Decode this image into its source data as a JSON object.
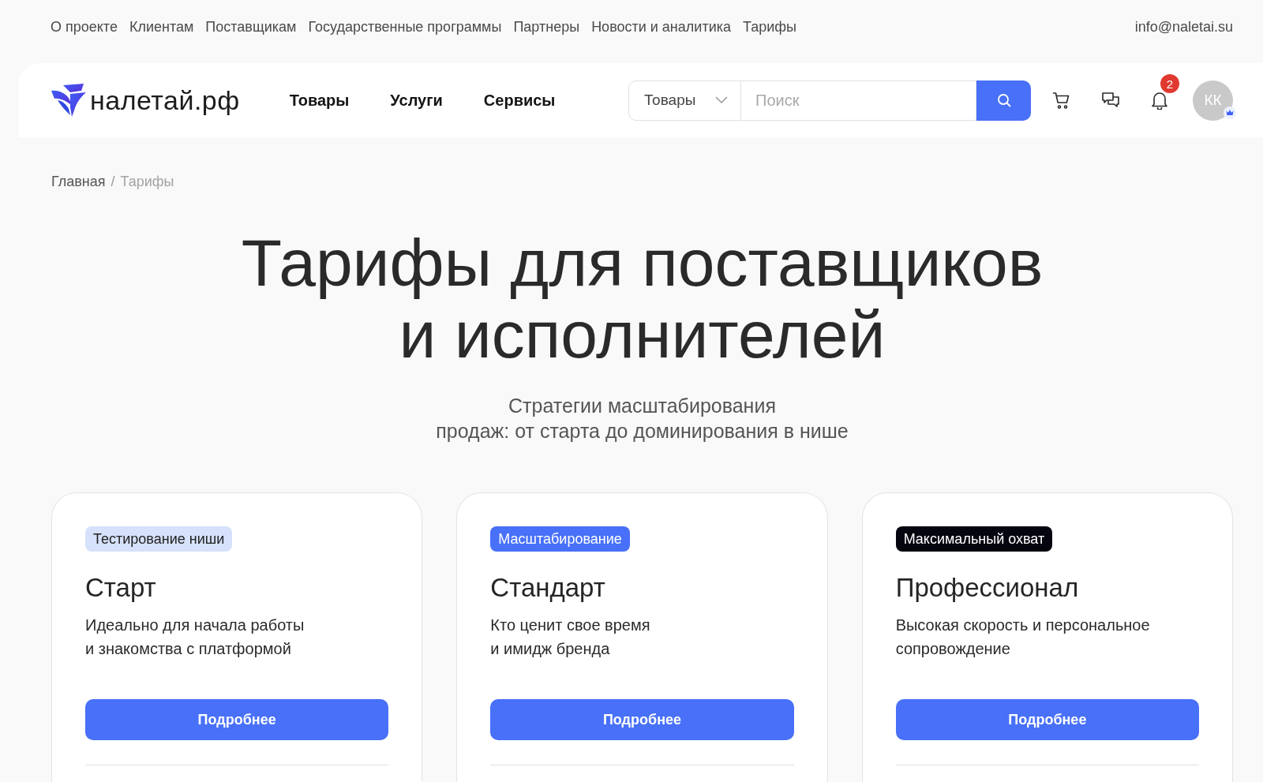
{
  "top_nav": {
    "links": [
      "О проекте",
      "Клиентам",
      "Поставщикам",
      "Государственные программы",
      "Партнеры",
      "Новости и аналитика",
      "Тарифы"
    ],
    "email": "info@naletai.su"
  },
  "header": {
    "logo": "налетай.рф",
    "nav": [
      "Товары",
      "Услуги",
      "Сервисы"
    ],
    "search": {
      "category": "Товары",
      "placeholder": "Поиск"
    },
    "notifications": "2",
    "avatar": "КК"
  },
  "breadcrumb": {
    "separator": "/",
    "items": [
      {
        "label": "Главная",
        "current": false
      },
      {
        "label": "Тарифы",
        "current": true
      }
    ]
  },
  "hero": {
    "title": [
      "Тарифы для поставщиков",
      "и исполнителей"
    ],
    "subtitle": [
      "Стратегии масштабирования",
      "продаж: от старта до доминирования в нише"
    ]
  },
  "plans": [
    {
      "badge": {
        "text": "Тестирование ниши",
        "kind": "soft"
      },
      "title": "Старт",
      "description": [
        "Идеально для начала работы",
        "и знакомства с платформой"
      ],
      "button": "Подробнее"
    },
    {
      "badge": {
        "text": "Масштабирование",
        "kind": "accent"
      },
      "title": "Стандарт",
      "description": [
        "Кто ценит свое время",
        "и имидж бренда"
      ],
      "button": "Подробнее"
    },
    {
      "badge": {
        "text": "Максимальный охват",
        "kind": "dark"
      },
      "title": "Профессионал",
      "description": [
        "Высокая скорость и персональное",
        "сопровождение"
      ],
      "button": "Подробнее"
    }
  ]
}
